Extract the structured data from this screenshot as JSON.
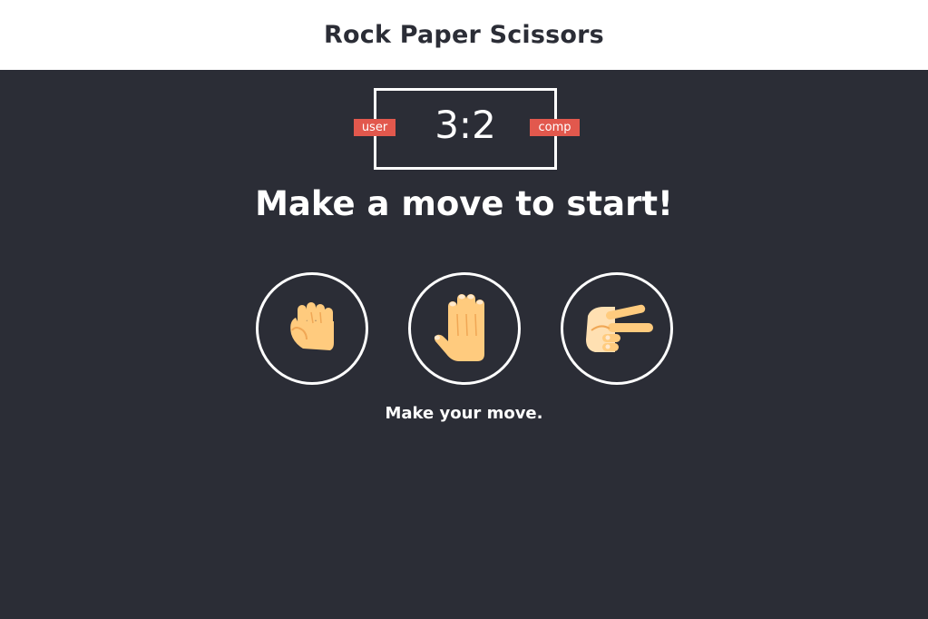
{
  "header": {
    "title": "Rock Paper Scissors"
  },
  "scoreboard": {
    "user_label": "user",
    "comp_label": "comp",
    "score": "3:2"
  },
  "result_message": "Make a move to start!",
  "choices": [
    {
      "id": "r",
      "icon": "rock-fist-icon"
    },
    {
      "id": "p",
      "icon": "paper-hand-icon"
    },
    {
      "id": "s",
      "icon": "scissors-hand-icon"
    }
  ],
  "action_message": "Make your move.",
  "colors": {
    "background": "#2b2d36",
    "header_bg": "#ffffff",
    "badge": "#e2584d",
    "skin": "#ffcb7e",
    "skin_light": "#ffe0b2"
  }
}
